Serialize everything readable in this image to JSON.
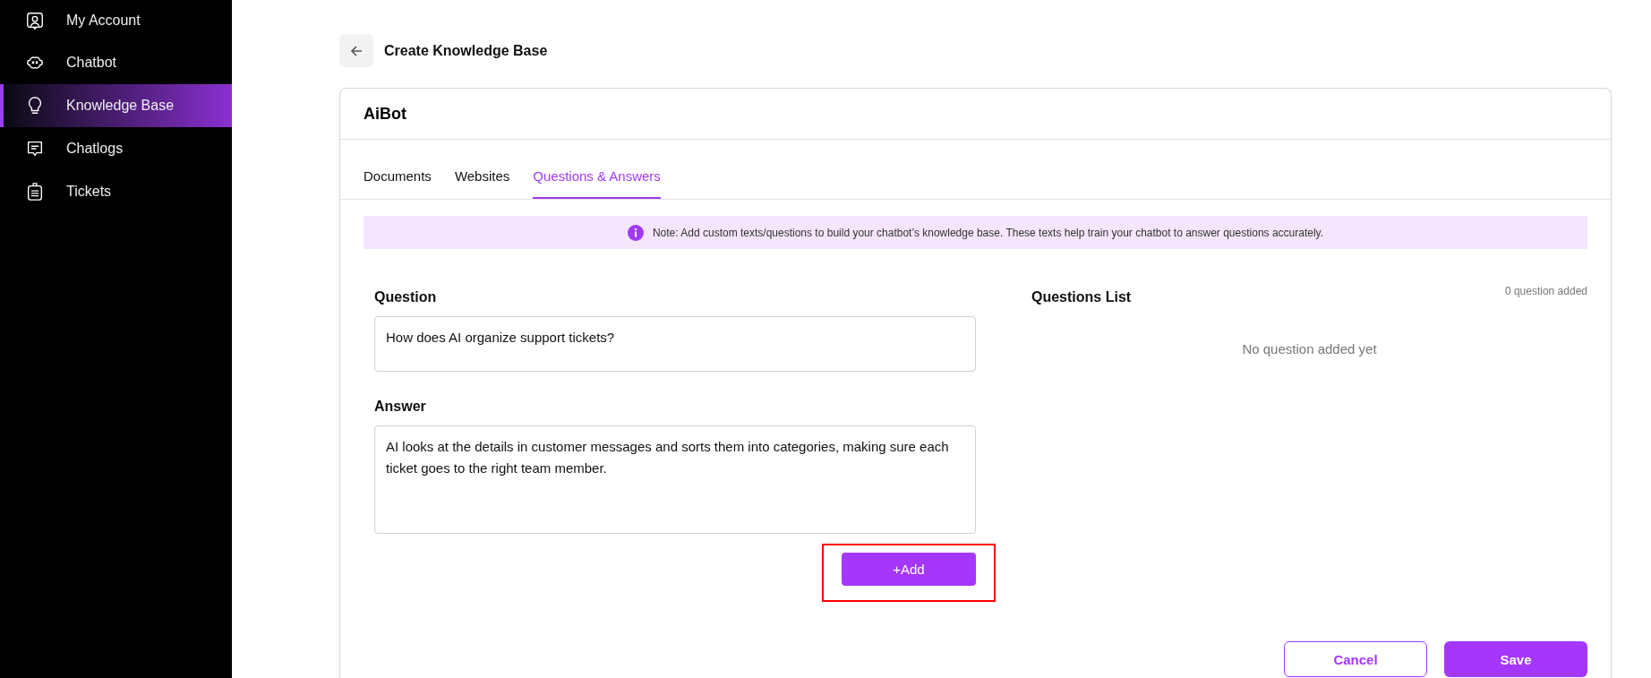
{
  "sidebar": {
    "items": [
      {
        "label": "My Account",
        "kind": "account",
        "selected": false
      },
      {
        "label": "Chatbot",
        "kind": "bot",
        "selected": false
      },
      {
        "label": "Knowledge Base",
        "kind": "bulb",
        "selected": true
      },
      {
        "label": "Chatlogs",
        "kind": "chat",
        "selected": false
      },
      {
        "label": "Tickets",
        "kind": "ticket",
        "selected": false
      }
    ]
  },
  "page_title": "Create Knowledge Base",
  "card": {
    "title": "AiBot",
    "tabs": [
      {
        "label": "Documents",
        "selected": false
      },
      {
        "label": "Websites",
        "selected": false
      },
      {
        "label": "Questions & Answers",
        "selected": true
      }
    ],
    "note": "Note: Add custom texts/questions to build your chatbot’s knowledge base. These texts help train your chatbot to answer questions accurately.",
    "question": {
      "label": "Question",
      "value": "How does AI organize support tickets?"
    },
    "answer": {
      "label": "Answer",
      "value": "AI looks at the details in customer messages and sorts them into categories, making sure each ticket goes to the right team member."
    },
    "add_button": {
      "label": "+Add",
      "highlighted": true
    },
    "questions_list": {
      "title": "Questions List",
      "count": "0 question added",
      "empty": "No question added yet"
    },
    "buttons": [
      {
        "label": "Cancel",
        "kind": "outline"
      },
      {
        "label": "Save",
        "kind": "primary"
      }
    ]
  }
}
